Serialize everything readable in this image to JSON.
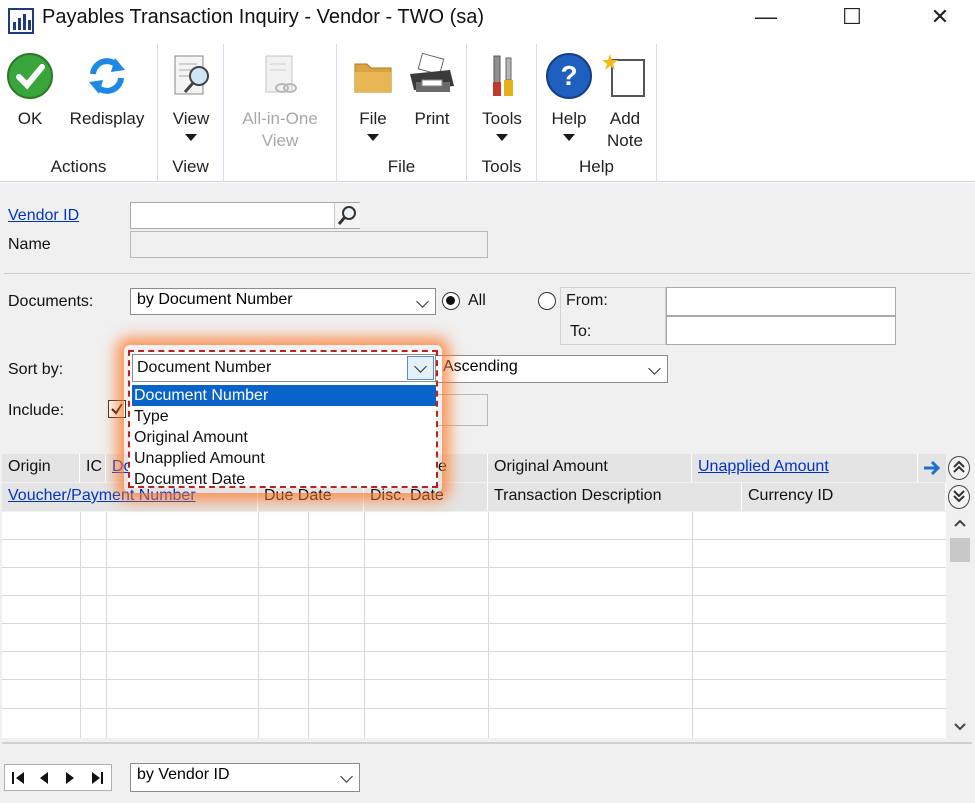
{
  "window": {
    "title": "Payables Transaction Inquiry - Vendor  -  TWO (sa)",
    "controls": [
      "—",
      "☐",
      "✕"
    ]
  },
  "ribbon": {
    "groups": [
      {
        "label": "Actions",
        "buttons": [
          {
            "label": "OK",
            "icon": "check-icon"
          },
          {
            "label": "Redisplay",
            "icon": "refresh-icon"
          }
        ]
      },
      {
        "label": "View",
        "buttons": [
          {
            "label": "View",
            "icon": "view-icon"
          }
        ]
      },
      {
        "label": "",
        "buttons": [
          {
            "label": "All-in-One View",
            "line1": "All-in-One",
            "line2": "View",
            "icon": "document-link-icon",
            "disabled": true
          }
        ]
      },
      {
        "label": "File",
        "buttons": [
          {
            "label": "File",
            "icon": "folder-icon"
          },
          {
            "label": "Print",
            "icon": "printer-icon"
          }
        ]
      },
      {
        "label": "Tools",
        "buttons": [
          {
            "label": "Tools",
            "icon": "tools-icon"
          }
        ]
      },
      {
        "label": "Help",
        "buttons": [
          {
            "label": "Help",
            "icon": "help-icon"
          },
          {
            "label": "Add Note",
            "line1": "Add",
            "line2": "Note",
            "icon": "note-icon"
          }
        ]
      }
    ]
  },
  "form": {
    "vendor_id_label": "Vendor ID",
    "vendor_id_value": "",
    "name_label": "Name",
    "name_value": "",
    "documents_label": "Documents:",
    "documents_value": "by Document Number",
    "all_label": "All",
    "from_label": "From:",
    "to_label": "To:",
    "from_value": "",
    "to_value": "",
    "sort_by_label": "Sort by:",
    "sort_by_value": "Document Number",
    "sort_order_value": "Ascending",
    "include_label": "Include:"
  },
  "sort_dropdown": {
    "options": [
      "Document Number",
      "Type",
      "Original Amount",
      "Unapplied Amount",
      "Document Date"
    ],
    "selected_index": 0
  },
  "grid": {
    "header_row1": {
      "origin": "Origin",
      "ic": "IC",
      "doc_partial": "Do",
      "date_partial": "e",
      "original_amount": "Original Amount",
      "unapplied_amount": "Unapplied Amount"
    },
    "header_row2": {
      "voucher": "Voucher/Payment Number",
      "due_date": "Due Date",
      "disc_date": "Disc. Date",
      "transaction_description": "Transaction Description",
      "currency_id": "Currency ID"
    },
    "rows": 8
  },
  "footer": {
    "browse_value": "by Vendor ID"
  },
  "colors": {
    "accent_blue": "#0a63c9",
    "link_blue": "#0033cc",
    "dropdown_highlight": "#c0201c",
    "form_bg": "#f0f0f0"
  }
}
